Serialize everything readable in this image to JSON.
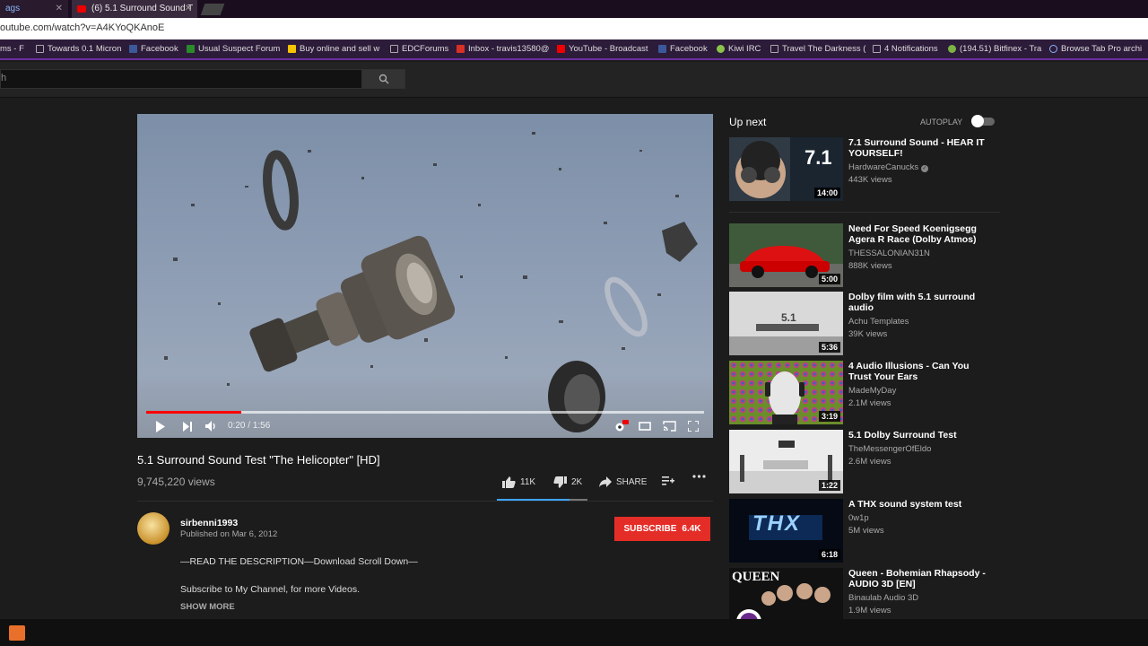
{
  "browser": {
    "tabs": [
      {
        "label": "ags"
      },
      {
        "label": "(6) 5.1 Surround Sound T"
      }
    ],
    "url": "outube.com/watch?v=A4KYoQKAnoE",
    "bookmarks": [
      "ms - F",
      "Towards 0.1 Micron",
      "Facebook",
      "Usual Suspect Forum",
      "Buy online and sell w",
      "EDCForums",
      "Inbox - travis13580@",
      "YouTube - Broadcast",
      "Facebook",
      "Kiwi IRC",
      "Travel The Darkness (",
      "4 Notifications",
      "(194.51) Bitfinex - Tra",
      "Browse Tab Pro archi"
    ]
  },
  "search": {
    "placeholder": "h"
  },
  "player": {
    "current_time": "0:20",
    "duration": "1:56",
    "played_fraction": 0.17,
    "loaded_fraction": 1.0,
    "hd_badge": "HD"
  },
  "video": {
    "title": "5.1 Surround Sound Test \"The Helicopter\" [HD]",
    "views": "9,745,220 views",
    "likes": "11K",
    "dislikes": "2K",
    "share_label": "SHARE",
    "like_fraction": 0.8
  },
  "channel": {
    "name": "sirbenni1993",
    "published": "Published on Mar 6, 2012",
    "subscribe_label": "SUBSCRIBE",
    "subscriber_count": "6.4K"
  },
  "description": {
    "line1": "—READ THE DESCRIPTION—Download Scroll Down—",
    "line2": "Subscribe to My Channel, for more Videos.",
    "show_more": "SHOW MORE"
  },
  "sidebar": {
    "up_next": "Up next",
    "autoplay": "AUTOPLAY",
    "items": [
      {
        "title": "7.1 Surround Sound - HEAR IT YOURSELF!",
        "channel": "HardwareCanucks",
        "views": "443K views",
        "duration": "14:00",
        "verified": true,
        "thumb_text": "7.1"
      },
      {
        "title": "Need For Speed Koenigsegg Agera R Race (Dolby Atmos)",
        "channel": "THESSALONIAN31N",
        "views": "888K views",
        "duration": "5:00"
      },
      {
        "title": "Dolby film with 5.1 surround audio",
        "channel": "Achu Templates",
        "views": "39K views",
        "duration": "5:36",
        "thumb_text": "5.1"
      },
      {
        "title": "4 Audio Illusions - Can You Trust Your Ears",
        "channel": "MadeMyDay",
        "views": "2.1M views",
        "duration": "3:19"
      },
      {
        "title": "5.1 Dolby Surround Test",
        "channel": "TheMessengerOfEldo",
        "views": "2.6M views",
        "duration": "1:22"
      },
      {
        "title": "A THX sound system test",
        "channel": "0w1p",
        "views": "5M views",
        "duration": "6:18",
        "thumb_text": "THX"
      },
      {
        "title": "Queen - Bohemian Rhapsody - AUDIO 3D [EN]",
        "channel": "Binaulab Audio 3D",
        "views": "1.9M views",
        "thumb_text": "QUEEN"
      }
    ]
  },
  "colors": {
    "subscribe": "#e52d27",
    "progress": "#ff0000",
    "accent": "#3ea6ff",
    "bookmark_bar": "#2d1b3a"
  }
}
